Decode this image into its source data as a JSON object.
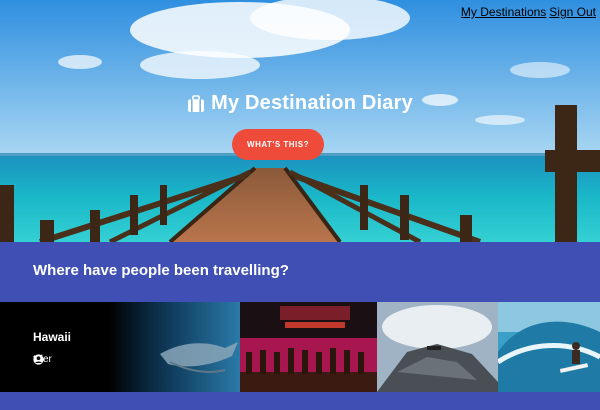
{
  "nav": {
    "my_destinations": "My Destinations",
    "sign_out": "Sign Out"
  },
  "hero": {
    "title": "My Destination Diary",
    "cta_label": "WHAT'S THIS?",
    "icon": "suitcase-icon"
  },
  "section": {
    "title": "Where have people been travelling?"
  },
  "cards": [
    {
      "name": "Hawaii",
      "user": "tyler",
      "user_icon": "user-circle-icon"
    },
    {
      "name": ""
    },
    {
      "name": ""
    },
    {
      "name": ""
    }
  ],
  "colors": {
    "accent_blue": "#3f4fb3",
    "cta_red": "#ef4b3b"
  }
}
